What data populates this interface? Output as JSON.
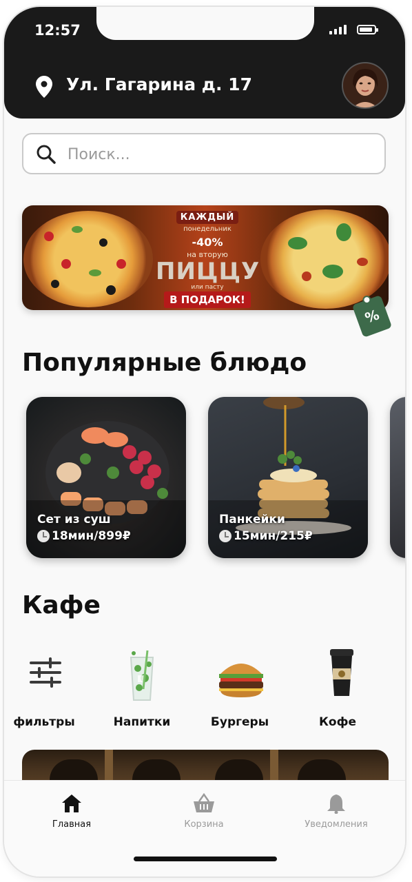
{
  "status_bar": {
    "time": "12:57"
  },
  "header": {
    "address": "Ул. Гагарина д. 17"
  },
  "search": {
    "placeholder": "Поиск..."
  },
  "promo_banner": {
    "line1": "КАЖДЫЙ",
    "line2": "понедельник",
    "discount": "-40%",
    "line3": "на вторую",
    "headline": "ПИЦЦУ",
    "line4": "или пасту",
    "gift": "В ПОДАРОК!",
    "tag_symbol": "%"
  },
  "popular": {
    "title": "Популярные блюдо",
    "items": [
      {
        "name": "Сет из суш",
        "meta": "18мин/899₽"
      },
      {
        "name": "Панкейки",
        "meta": "15мин/215₽"
      }
    ]
  },
  "cafe": {
    "title": "Кафе",
    "categories": [
      {
        "label": "фильтры",
        "icon": "filter-sliders-icon"
      },
      {
        "label": "Напитки",
        "icon": "drink-glass-icon"
      },
      {
        "label": "Бургеры",
        "icon": "burger-icon"
      },
      {
        "label": "Кофе",
        "icon": "coffee-cup-icon"
      }
    ]
  },
  "tabbar": {
    "items": [
      {
        "label": "Главная",
        "icon": "home-icon",
        "active": true
      },
      {
        "label": "Корзина",
        "icon": "basket-icon",
        "active": false
      },
      {
        "label": "Уведомления",
        "icon": "bell-icon",
        "active": false
      }
    ]
  },
  "colors": {
    "header_bg": "#1a1a1a",
    "tag_green": "#3d6a4a",
    "banner_red": "#b51a1a"
  }
}
